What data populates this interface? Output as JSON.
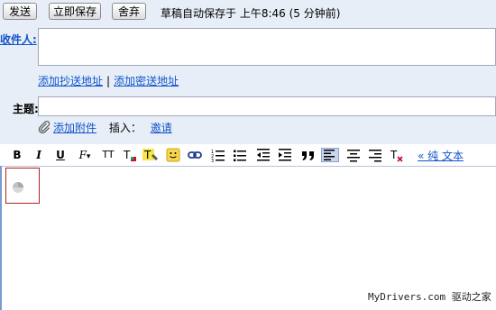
{
  "toolbar": {
    "send_label": "发送",
    "save_now_label": "立即保存",
    "discard_label": "舍弃",
    "draft_status": "草稿自动保存于 上午8:46 (5 分钟前)"
  },
  "compose": {
    "to_label": "收件人:",
    "to_value": "",
    "add_cc_label": "添加抄送地址",
    "separator": "|",
    "add_bcc_label": "添加密送地址",
    "subject_label": "主题:",
    "subject_value": "",
    "attach_label": "添加附件",
    "insert_label": "插入：",
    "invite_label": "邀请"
  },
  "format_toolbar": {
    "bold": "B",
    "italic": "I",
    "underline": "U",
    "font": "F",
    "size": "TT",
    "plain_text_label": "« 纯 文本"
  },
  "footer": {
    "watermark": "MyDrivers.com 驱动之家"
  }
}
